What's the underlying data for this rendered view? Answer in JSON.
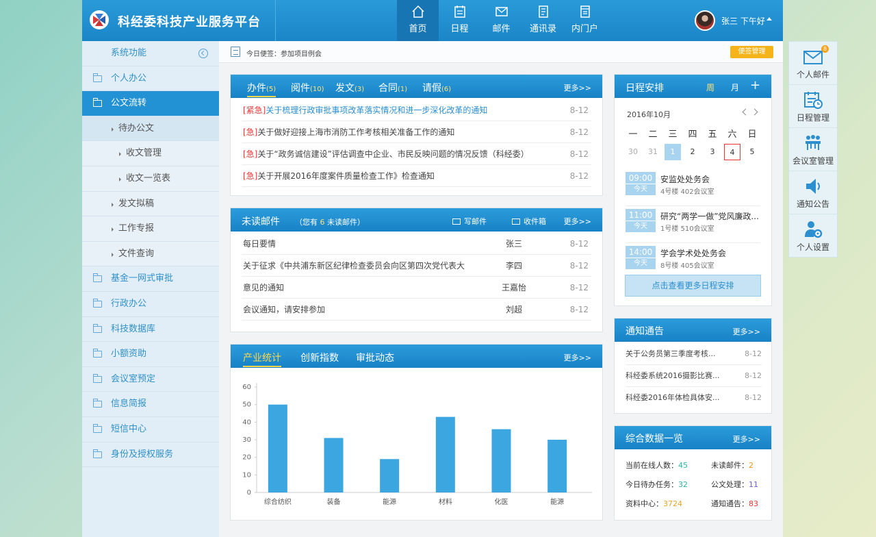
{
  "app": {
    "title": "科经委科技产业服务平台"
  },
  "nav": [
    {
      "label": "首页",
      "icon": "home-icon"
    },
    {
      "label": "日程",
      "icon": "calendar-icon"
    },
    {
      "label": "邮件",
      "icon": "mail-icon"
    },
    {
      "label": "通讯录",
      "icon": "address-book-icon"
    },
    {
      "label": "内门户",
      "icon": "portal-icon"
    }
  ],
  "user": {
    "greeting": "张三 下午好"
  },
  "sidebar": {
    "header": "系统功能",
    "items": [
      {
        "label": "个人办公"
      },
      {
        "label": "公文流转"
      },
      {
        "label": "待办公文"
      },
      {
        "label": "收文管理"
      },
      {
        "label": "收文一览表"
      },
      {
        "label": "发文拟稿"
      },
      {
        "label": "工作专报"
      },
      {
        "label": "文件查询"
      },
      {
        "label": "基金一网式审批"
      },
      {
        "label": "行政办公"
      },
      {
        "label": "科技数据库"
      },
      {
        "label": "小额资助"
      },
      {
        "label": "会议室预定"
      },
      {
        "label": "信息简报"
      },
      {
        "label": "短信中心"
      },
      {
        "label": "身份及授权服务"
      }
    ]
  },
  "memo": {
    "text": "今日便签：参加项目例会",
    "button": "便签管理"
  },
  "tasks": {
    "tabs": [
      {
        "label": "办件",
        "count": "(5)"
      },
      {
        "label": "阅件",
        "count": "(10)"
      },
      {
        "label": "发文",
        "count": "(3)"
      },
      {
        "label": "合同",
        "count": "(1)"
      },
      {
        "label": "请假",
        "count": "(6)"
      }
    ],
    "more": "更多>>",
    "rows": [
      {
        "tag": "[紧急]",
        "title": "关于梳理行政审批事项改革落实情况和进一步深化改革的通知",
        "date": "8-12"
      },
      {
        "tag": "[急]",
        "title": "关于做好迎接上海市消防工作考核相关准备工作的通知",
        "date": "8-12"
      },
      {
        "tag": "[急]",
        "title": "关于“政务诚信建设”评估调查中企业、市民反映问题的情况反馈（科经委）",
        "date": "8-12"
      },
      {
        "tag": "[急]",
        "title": "关于开展2016年度案件质量检查工作》检查通知",
        "date": "8-12"
      }
    ]
  },
  "mail": {
    "title": "未读邮件",
    "count_prefix": "（您有",
    "count": "6",
    "count_suffix": "未读邮件）",
    "compose": "写邮件",
    "inbox": "收件箱",
    "more": "更多>>",
    "rows": [
      {
        "subject": "每日要情",
        "sender": "张三",
        "date": "8-12"
      },
      {
        "subject": "关于征求《中共浦东新区纪律检查委员会向区第四次党代表大",
        "sender": "李四",
        "date": "8-12"
      },
      {
        "subject": "意见的通知",
        "sender": "王嘉怡",
        "date": "8-12"
      },
      {
        "subject": "会议通知，请安排参加",
        "sender": "刘超",
        "date": "8-12"
      }
    ]
  },
  "stats": {
    "tabs": [
      "产业统计",
      "创新指数",
      "审批动态"
    ],
    "more": "更多>>"
  },
  "chart_data": {
    "type": "bar",
    "categories": [
      "综合纺织",
      "装备",
      "能源",
      "材料",
      "化医",
      "能源"
    ],
    "values": [
      50,
      31,
      19,
      43,
      36,
      30
    ],
    "yticks": [
      0,
      10,
      20,
      30,
      40,
      50,
      60
    ],
    "ylim": [
      0,
      60
    ],
    "grid": false,
    "color": "#3ba6e0"
  },
  "schedule": {
    "title": "日程安排",
    "week": "周",
    "month": "月",
    "add": "+",
    "date": "2016年10月",
    "weekdays": [
      "一",
      "二",
      "三",
      "四",
      "五",
      "六",
      "日"
    ],
    "days": [
      "30",
      "31",
      "1",
      "2",
      "3",
      "4",
      "5"
    ],
    "events": [
      {
        "time": "09:00",
        "day": "今天",
        "title": "安监处处务会",
        "location": "4号楼 402会议室"
      },
      {
        "time": "11:00",
        "day": "今天",
        "title": "研究“两学一做”党风廉政...",
        "location": "1号楼 510会议室"
      },
      {
        "time": "14:00",
        "day": "今天",
        "title": "学会学术处处务会",
        "location": "8号楼 405会议室"
      }
    ],
    "more_button": "点击查看更多日程安排"
  },
  "notice": {
    "title": "通知通告",
    "more": "更多>>",
    "rows": [
      {
        "title": "关于公务员第三季度考核...",
        "date": "8-12"
      },
      {
        "title": "科经委系统2016摄影比赛...",
        "date": "8-12"
      },
      {
        "title": "科经委2016年体检具体安...",
        "date": "8-12"
      }
    ]
  },
  "data_overview": {
    "title": "综合数据一览",
    "more": "更多>>",
    "items": [
      {
        "label": "当前在线人数：",
        "value": "45",
        "color": "#2bb3a8"
      },
      {
        "label": "未读邮件：",
        "value": "2",
        "color": "#f29419"
      },
      {
        "label": "今日待办任务：",
        "value": "32",
        "color": "#2bb3a8"
      },
      {
        "label": "公文处理：",
        "value": "11",
        "color": "#6a5acd"
      },
      {
        "label": "资料中心：",
        "value": "3724",
        "color": "#e8a524"
      },
      {
        "label": "通知通告：",
        "value": "83",
        "color": "#e33"
      }
    ]
  },
  "dock": {
    "badge": "8",
    "items": [
      {
        "label": "个人邮件",
        "icon": "envelope-icon"
      },
      {
        "label": "日程管理",
        "icon": "calendar-clock-icon"
      },
      {
        "label": "会议室管理",
        "icon": "meeting-room-icon"
      },
      {
        "label": "通知公告",
        "icon": "speaker-icon"
      },
      {
        "label": "个人设置",
        "icon": "user-settings-icon"
      }
    ]
  },
  "colors": {
    "primary": "#1a86c8",
    "accent": "#ffd84a",
    "urgent": "#e33333",
    "memo_button": "#f7b31a"
  }
}
